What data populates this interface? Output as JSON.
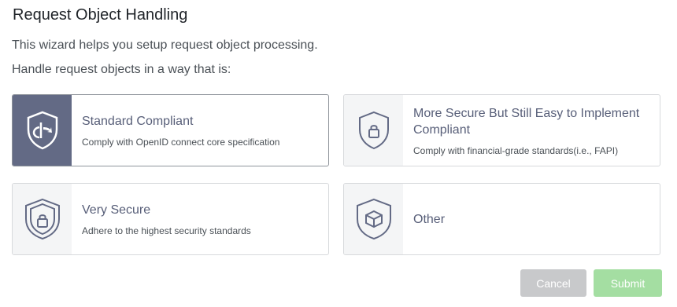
{
  "title": "Request Object Handling",
  "intro": "This wizard helps you setup request object processing.",
  "prompt": "Handle request objects in a way that is:",
  "options": [
    {
      "label": "Standard Compliant",
      "description": "Comply with OpenID connect core specification",
      "icon": "openid-shield-icon",
      "selected": true
    },
    {
      "label": "More Secure But Still Easy to Implement Compliant",
      "description": "Comply with financial-grade standards(i.e., FAPI)",
      "icon": "lock-shield-icon",
      "selected": false
    },
    {
      "label": "Very Secure",
      "description": "Adhere to the highest security standards",
      "icon": "double-lock-shield-icon",
      "selected": false
    },
    {
      "label": "Other",
      "description": "",
      "icon": "cube-shield-icon",
      "selected": false
    }
  ],
  "buttons": {
    "cancel": "Cancel",
    "submit": "Submit"
  },
  "colors": {
    "selected_icon_bg": "#636a85",
    "submit": "#a4dea2",
    "cancel": "#c8c9cb",
    "label": "#575e78"
  }
}
